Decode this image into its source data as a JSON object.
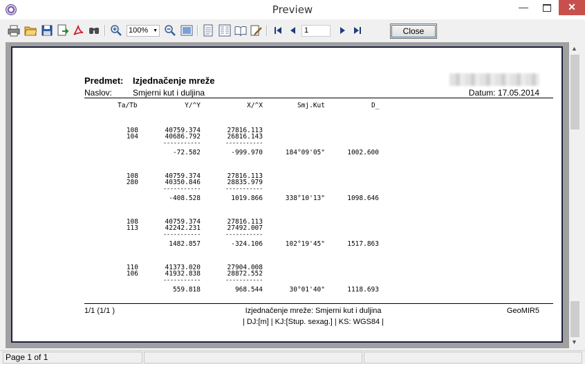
{
  "window": {
    "title": "Preview"
  },
  "toolbar": {
    "zoom_value": "100%",
    "page_value": "1",
    "close_label": "Close",
    "icons": [
      "print-icon",
      "open-folder-icon",
      "save-icon",
      "export-icon",
      "pdf-icon",
      "find-icon",
      "zoom-in-icon",
      "zoom-select",
      "zoom-out-icon",
      "fit-page-icon",
      "single-page-icon",
      "two-page-icon",
      "book-icon",
      "edit-icon",
      "first-page-icon",
      "prev-page-icon",
      "next-page-icon",
      "last-page-icon"
    ]
  },
  "report": {
    "subject_label": "Predmet:",
    "subject_value": "Izjednačenje mreže",
    "title_label": "Naslov:",
    "title_value": "Smjerni kut i duljina",
    "date_text": "Datum: 17.05.2014",
    "columns": [
      "Ta/Tb",
      "Y/^Y",
      "X/^X",
      "Smj.Kut",
      "D_"
    ],
    "blocks": [
      {
        "from": "108",
        "to": "104",
        "y1": "40759.374",
        "y2": "40686.792",
        "x1": "27816.113",
        "x2": "26816.143",
        "dy": "-72.582",
        "dx": "-999.970",
        "angle": "184°09'05\"",
        "dist": "1002.600"
      },
      {
        "from": "108",
        "to": "280",
        "y1": "40759.374",
        "y2": "40350.846",
        "x1": "27816.113",
        "x2": "28835.979",
        "dy": "-408.528",
        "dx": "1019.866",
        "angle": "338°10'13\"",
        "dist": "1098.646"
      },
      {
        "from": "108",
        "to": "113",
        "y1": "40759.374",
        "y2": "42242.231",
        "x1": "27816.113",
        "x2": "27492.007",
        "dy": "1482.857",
        "dx": "-324.106",
        "angle": "102°19'45\"",
        "dist": "1517.863"
      },
      {
        "from": "110",
        "to": "106",
        "y1": "41373.020",
        "y2": "41932.838",
        "x1": "27904.008",
        "x2": "28872.552",
        "dy": "559.818",
        "dx": "968.544",
        "angle": "30°01'40\"",
        "dist": "1118.693"
      }
    ],
    "dashes": "-----------",
    "footer_page": "1/1 (1/1 )",
    "footer_title": "Izjednačenje mreže: Smjerni kut i duljina",
    "footer_app": "GeoMIR5",
    "footer_info": "| DJ:[m] | KJ:[Stup. sexag.] | KS: WGS84 |"
  },
  "status": {
    "page_text": "Page 1 of 1"
  },
  "colors": {
    "close_red": "#c7504d",
    "page_border": "#1a2040",
    "viewport_bg": "#a0a0a0"
  }
}
